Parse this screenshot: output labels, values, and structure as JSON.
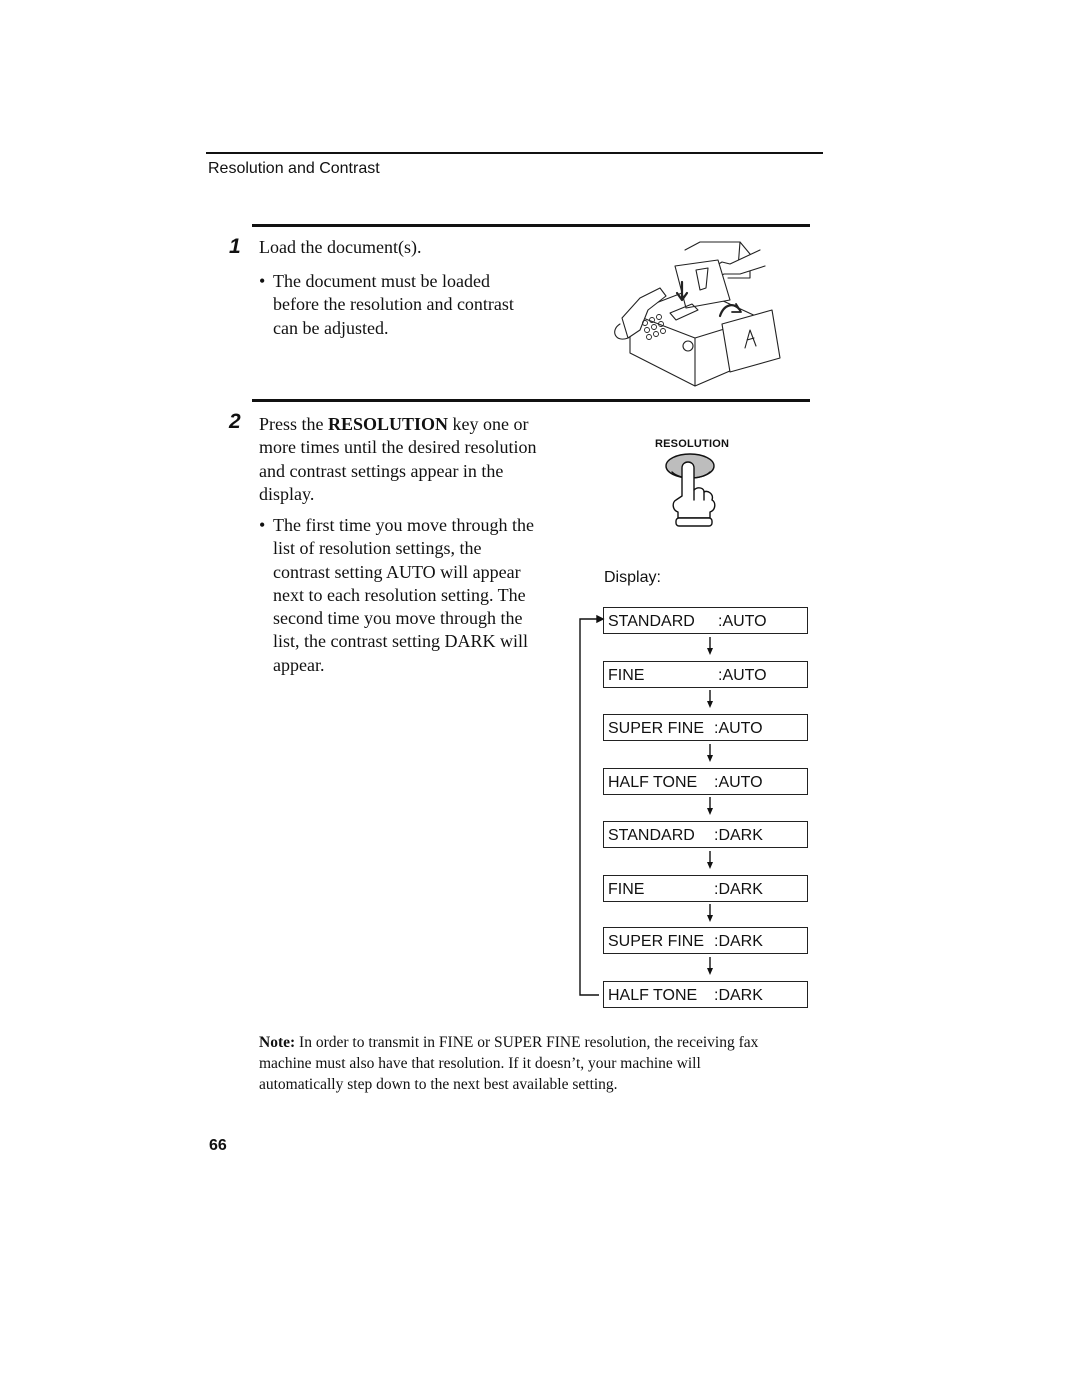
{
  "header": {
    "section_title": "Resolution and Contrast"
  },
  "steps": [
    {
      "number": "1",
      "instruction": "Load the document(s).",
      "bullets": [
        {
          "lines": [
            "The document must be loaded",
            "before the resolution and contrast",
            "can be adjusted."
          ]
        }
      ],
      "illustration": "fax-machine-loading-document-illustration"
    },
    {
      "number": "2",
      "instruction_prefix": "Press the ",
      "instruction_key": "RESOLUTION",
      "instruction_suffix": " key one or",
      "instruction_lines": [
        "more times until the desired resolution",
        "and contrast settings appear in the",
        "display."
      ],
      "bullets": [
        {
          "lines": [
            "The first time you move through the",
            "list of resolution settings, the",
            "contrast setting AUTO will appear",
            "next to each resolution setting. The",
            "second time you move through the",
            "list, the contrast setting DARK will",
            "appear."
          ]
        }
      ],
      "key_label": "RESOLUTION",
      "key_icon": "finger-pressing-key-icon"
    }
  ],
  "display": {
    "label": "Display:",
    "sequence": [
      {
        "resolution": "STANDARD",
        "contrast": ":AUTO"
      },
      {
        "resolution": "FINE",
        "contrast": ":AUTO"
      },
      {
        "resolution": "SUPER FINE",
        "contrast": ":AUTO"
      },
      {
        "resolution": "HALF TONE",
        "contrast": ":AUTO"
      },
      {
        "resolution": "STANDARD",
        "contrast": ":DARK"
      },
      {
        "resolution": "FINE",
        "contrast": ":DARK"
      },
      {
        "resolution": "SUPER FINE",
        "contrast": ":DARK"
      },
      {
        "resolution": "HALF TONE",
        "contrast": ":DARK"
      }
    ]
  },
  "note": {
    "label": "Note:",
    "text": " In order to transmit in FINE or SUPER FINE resolution, the receiving fax machine must also have that resolution. If it doesn’t, your machine will automatically step down to the next best available setting."
  },
  "footer": {
    "page_number": "66"
  }
}
